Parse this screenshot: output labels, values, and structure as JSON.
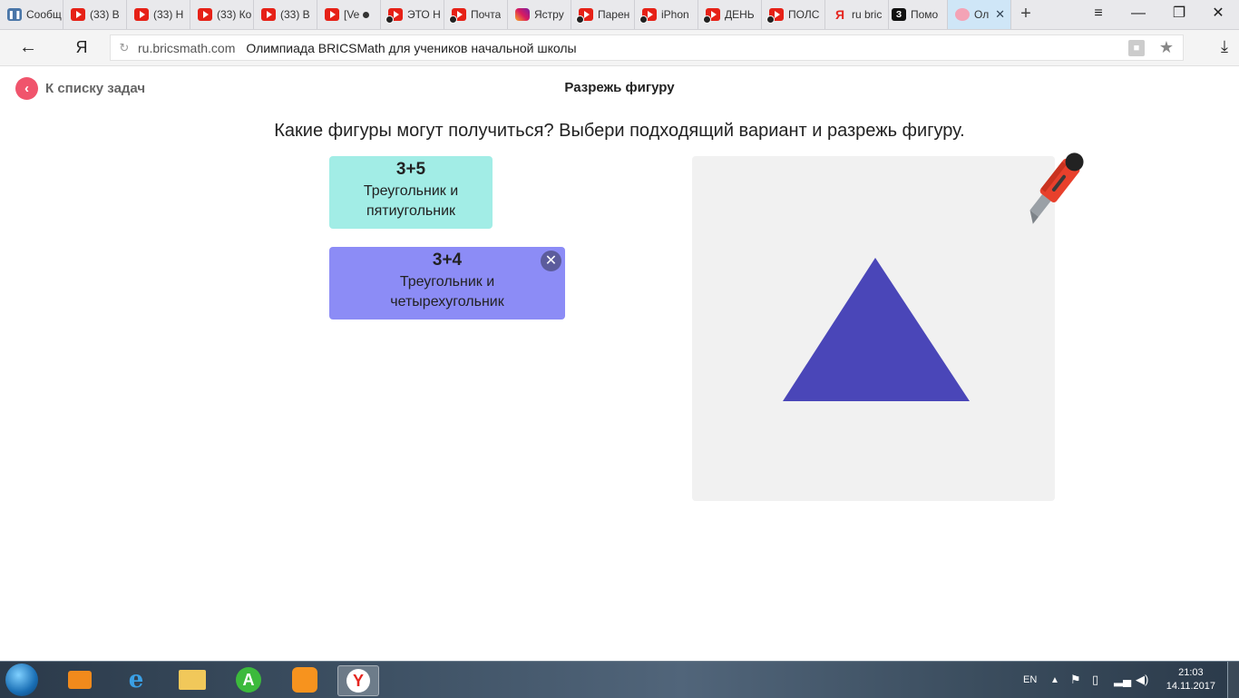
{
  "browser": {
    "tabs": [
      {
        "label": "Сообщ",
        "icon": "vk-icon"
      },
      {
        "label": "(33) В",
        "icon": "youtube-icon"
      },
      {
        "label": "(33) Н",
        "icon": "youtube-icon"
      },
      {
        "label": "(33) Ко",
        "icon": "youtube-icon"
      },
      {
        "label": "(33) В",
        "icon": "youtube-icon"
      },
      {
        "label": "[Ve",
        "icon": "youtube-icon"
      },
      {
        "label": "ЭТО Н",
        "icon": "youtube-icon"
      },
      {
        "label": "Почта",
        "icon": "youtube-icon"
      },
      {
        "label": "Ястру",
        "icon": "instagram-icon"
      },
      {
        "label": "Парен",
        "icon": "youtube-icon"
      },
      {
        "label": "iPhon",
        "icon": "youtube-icon"
      },
      {
        "label": "ДЕНЬ",
        "icon": "youtube-icon"
      },
      {
        "label": "ПОЛС",
        "icon": "youtube-icon"
      },
      {
        "label": "ru bric",
        "icon": "yandex-icon"
      },
      {
        "label": "Помо",
        "icon": "zen-icon"
      },
      {
        "label": "Ол",
        "icon": "bricsmath-icon",
        "active": true
      }
    ],
    "address": {
      "domain": "ru.bricsmath.com",
      "title": "Олимпиада BRICSMath для учеников начальной школы"
    },
    "nav_icon_labels": {
      "back": "←",
      "yandex": "Я",
      "reload": "↻",
      "star": "★",
      "download": "⤓"
    },
    "window_controls": {
      "menu": "≡",
      "minimize": "—",
      "restore": "❐",
      "close": "✕"
    }
  },
  "page": {
    "back_label": "К списку задач",
    "back_glyph": "‹",
    "task_title": "Разрежь фигуру",
    "question": "Какие фигуры могут получиться? Выбери подходящий вариант и разрежь фигуру.",
    "options": [
      {
        "formula": "3+5",
        "desc_line1": "Треугольник и",
        "desc_line2": "пятиугольник",
        "color": "#a2ede6"
      },
      {
        "formula": "3+4",
        "desc_line1": "Треугольник и",
        "desc_line2": "четырехугольник",
        "color": "#8c8cf6",
        "selected": true
      }
    ],
    "close_glyph": "✕",
    "shape": {
      "type": "triangle",
      "color": "#4a46b8"
    },
    "tool_icon": "utility-knife-icon"
  },
  "taskbar": {
    "language": "EN",
    "time": "21:03",
    "date": "14.11.2017",
    "apps": [
      "media-player-icon",
      "internet-explorer-icon",
      "file-explorer-icon",
      "android-emulator-icon",
      "uc-browser-icon",
      "yandex-browser-icon"
    ]
  }
}
